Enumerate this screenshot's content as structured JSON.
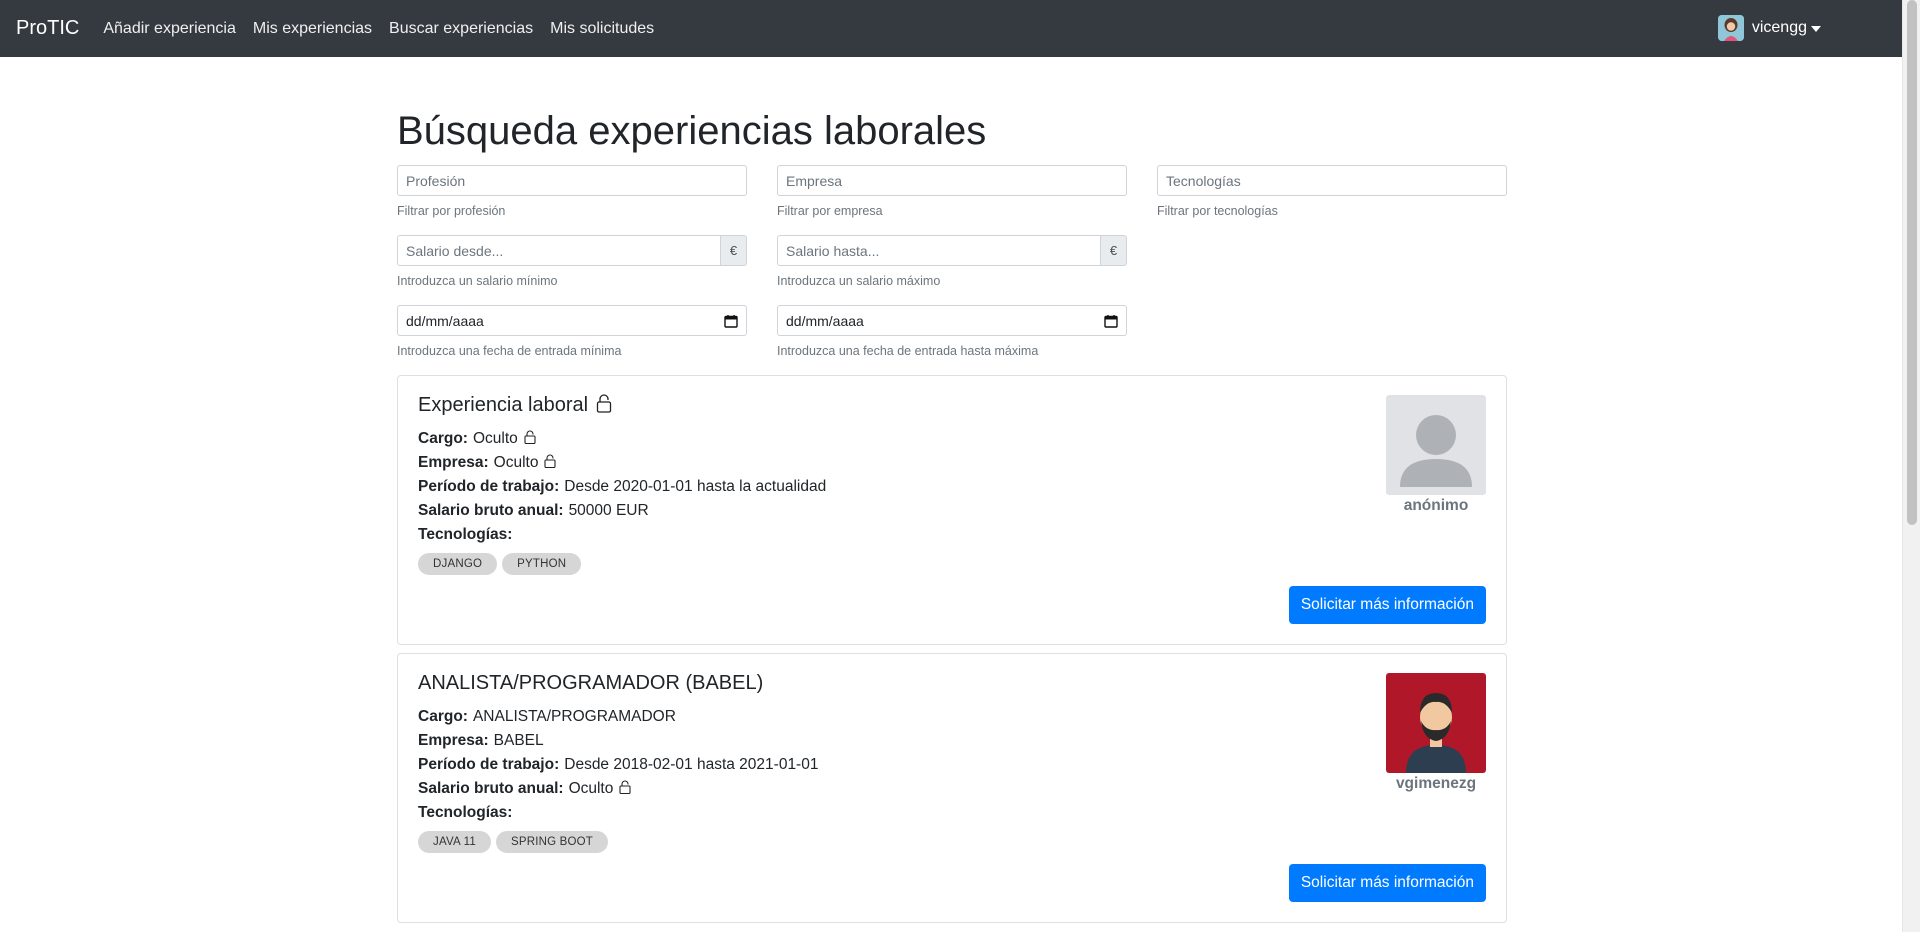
{
  "navbar": {
    "brand": "ProTIC",
    "links": [
      "Añadir experiencia",
      "Mis experiencias",
      "Buscar experiencias",
      "Mis solicitudes"
    ],
    "username": "vicengg"
  },
  "page": {
    "title": "Búsqueda experiencias laborales"
  },
  "filters": {
    "profesion": {
      "placeholder": "Profesión",
      "help": "Filtrar por profesión"
    },
    "empresa": {
      "placeholder": "Empresa",
      "help": "Filtrar por empresa"
    },
    "tecnologias": {
      "placeholder": "Tecnologías",
      "help": "Filtrar por tecnologías"
    },
    "salario_desde": {
      "placeholder": "Salario desde...",
      "addon": "€",
      "help": "Introduzca un salario mínimo"
    },
    "salario_hasta": {
      "placeholder": "Salario hasta...",
      "addon": "€",
      "help": "Introduzca un salario máximo"
    },
    "fecha_desde": {
      "value": "dd/mm/aaaa",
      "help": "Introduzca una fecha de entrada mínima"
    },
    "fecha_hasta": {
      "value": "dd/mm/aaaa",
      "help": "Introduzca una fecha de entrada hasta máxima"
    }
  },
  "labels": {
    "cargo": "Cargo:",
    "empresa": "Empresa:",
    "periodo": "Período de trabajo:",
    "salario": "Salario bruto anual:",
    "tecnologias": "Tecnologías:",
    "button": "Solicitar más información"
  },
  "experiences": [
    {
      "title": "Experiencia laboral",
      "title_locked": true,
      "cargo": "Oculto",
      "empresa": "Oculto",
      "periodo": "Desde 2020-01-01 hasta la actualidad",
      "salario": "50000 EUR",
      "tecnologias": [
        "DJANGO",
        "PYTHON"
      ],
      "user": "anónimo"
    },
    {
      "title": "ANALISTA/PROGRAMADOR (BABEL)",
      "title_locked": false,
      "cargo": "ANALISTA/PROGRAMADOR",
      "empresa": "BABEL",
      "periodo": "Desde 2018-02-01 hasta 2021-01-01",
      "salario": "Oculto",
      "tecnologias": [
        "JAVA 11",
        "SPRING BOOT"
      ],
      "user": "vgimenezg"
    }
  ],
  "colors": {
    "navbar": "#343a40",
    "primary": "#007bff",
    "badge": "#d6d6d6",
    "muted": "#6c757d"
  }
}
